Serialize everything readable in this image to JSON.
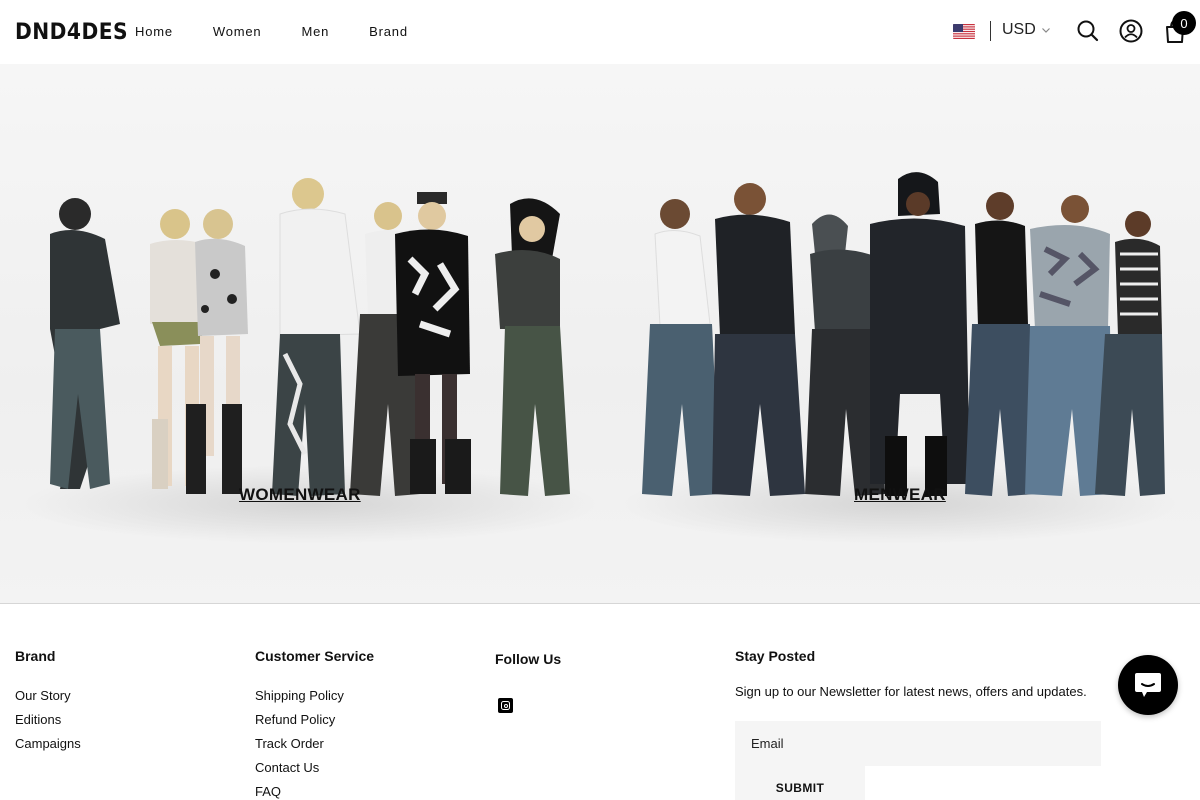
{
  "header": {
    "logo": "DND4DES",
    "nav": [
      "Home",
      "Women",
      "Men",
      "Brand"
    ],
    "currency": "USD",
    "cart_count": "0",
    "icons": [
      "us-flag-icon",
      "chevron-down-icon",
      "search-icon",
      "account-icon",
      "cart-icon"
    ]
  },
  "hero": {
    "collections": [
      {
        "label": "WOMENWEAR"
      },
      {
        "label": "MENWEAR"
      }
    ]
  },
  "footer": {
    "brand": {
      "heading": "Brand",
      "links": [
        "Our Story",
        "Editions",
        "Campaigns"
      ]
    },
    "service": {
      "heading": "Customer Service",
      "links": [
        "Shipping Policy",
        "Refund Policy",
        "Track Order",
        "Contact Us",
        "FAQ"
      ]
    },
    "follow": {
      "heading": "Follow Us",
      "icons": [
        "instagram-icon"
      ]
    },
    "newsletter": {
      "heading": "Stay Posted",
      "text": "Sign up to our Newsletter for latest news, offers and updates.",
      "email_placeholder": "Email",
      "submit_label": "SUBMIT"
    }
  },
  "chat_icon": "chat-icon",
  "colors": {
    "accent": "#000000",
    "hero_bg": "#f1f1f1",
    "input_bg": "#f5f5f5"
  }
}
